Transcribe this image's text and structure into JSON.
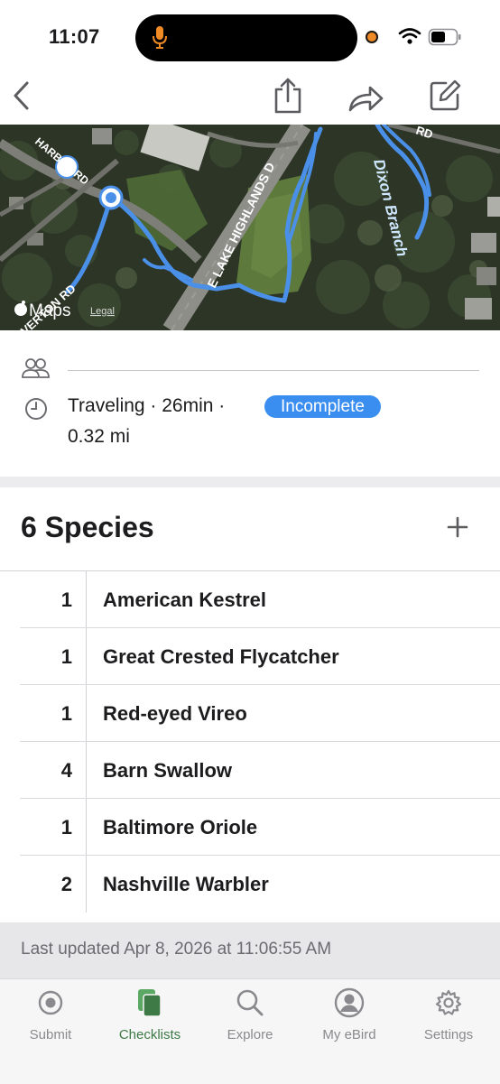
{
  "status_bar": {
    "time": "11:07"
  },
  "map": {
    "roads": [
      "HARBOR RD",
      "RIVERTON RD",
      "E LAKE HIGHLANDS D",
      "Dixon Branch",
      "RD"
    ],
    "attribution": "Maps",
    "legal": "Legal"
  },
  "checklist": {
    "trip_line1": "Traveling · 26min ·",
    "trip_line2": "0.32 mi",
    "status_badge": "Incomplete"
  },
  "species": {
    "title": "6 Species",
    "rows": [
      {
        "count": "1",
        "name": "American Kestrel"
      },
      {
        "count": "1",
        "name": "Great Crested Flycatcher"
      },
      {
        "count": "1",
        "name": "Red-eyed Vireo"
      },
      {
        "count": "4",
        "name": "Barn Swallow"
      },
      {
        "count": "1",
        "name": "Baltimore Oriole"
      },
      {
        "count": "2",
        "name": "Nashville Warbler"
      }
    ]
  },
  "footer": {
    "last_updated": "Last updated Apr 8, 2026 at 11:06:55 AM"
  },
  "tabbar": {
    "tabs": [
      {
        "label": "Submit",
        "icon": "submit-icon",
        "active": false
      },
      {
        "label": "Checklists",
        "icon": "checklists-icon",
        "active": true
      },
      {
        "label": "Explore",
        "icon": "search-icon",
        "active": false
      },
      {
        "label": "My eBird",
        "icon": "profile-icon",
        "active": false
      },
      {
        "label": "Settings",
        "icon": "gear-icon",
        "active": false
      }
    ]
  },
  "colors": {
    "accent_blue": "#3a8ef0",
    "route_blue": "#4a90e8",
    "active_tab_green": "#3d7a45",
    "inactive_tab_gray": "#8a8a8e"
  }
}
